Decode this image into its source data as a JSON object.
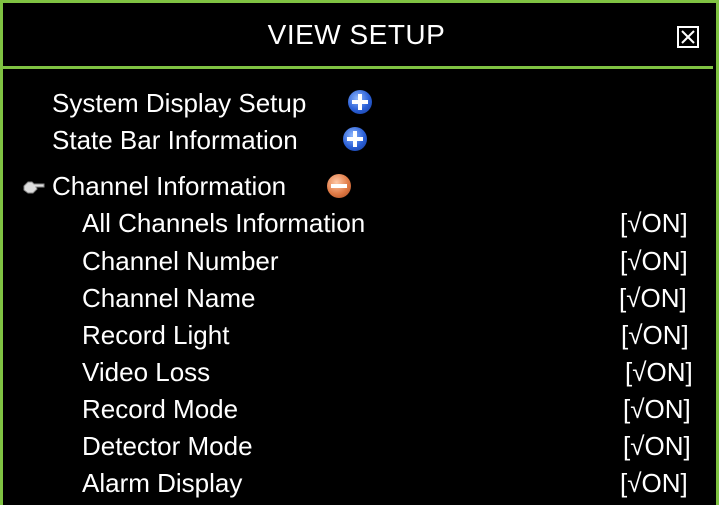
{
  "title": "VIEW SETUP",
  "sections": [
    {
      "label": "System Display Setup",
      "icon": "expand-plus-icon"
    },
    {
      "label": "State Bar Information",
      "icon": "expand-plus-icon"
    },
    {
      "label": "Channel Information",
      "icon": "collapse-minus-icon"
    }
  ],
  "options": [
    {
      "label": "All Channels Information",
      "value": "[√ON]"
    },
    {
      "label": "Channel Number",
      "value": "[√ON]"
    },
    {
      "label": "Channel Name",
      "value": "[√ON]"
    },
    {
      "label": "Record Light",
      "value": "[√ON]"
    },
    {
      "label": "Video Loss",
      "value": "[√ON]"
    },
    {
      "label": "Record Mode",
      "value": "[√ON]"
    },
    {
      "label": "Detector Mode",
      "value": "[√ON]"
    },
    {
      "label": "Alarm Display",
      "value": "[√ON]"
    }
  ],
  "colors": {
    "border": "#7fc242",
    "background": "#000000",
    "text": "#ffffff"
  }
}
